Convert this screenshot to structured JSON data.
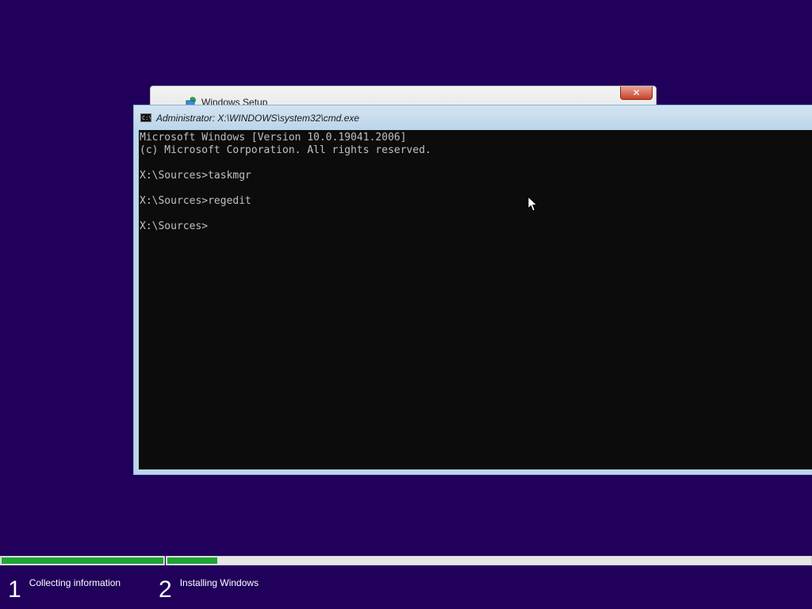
{
  "setup_window": {
    "title": "Windows Setup",
    "close_label": "✕"
  },
  "cmd_window": {
    "title": "Administrator: X:\\WINDOWS\\system32\\cmd.exe",
    "icon_text": "C:\\",
    "lines": [
      "Microsoft Windows [Version 10.0.19041.2006]",
      "(c) Microsoft Corporation. All rights reserved.",
      "",
      "X:\\Sources>taskmgr",
      "",
      "X:\\Sources>regedit",
      "",
      "X:\\Sources>"
    ]
  },
  "progress": {
    "steps": [
      {
        "number": "1",
        "label": "Collecting information",
        "progress": 1.0
      },
      {
        "number": "2",
        "label": "Installing Windows",
        "progress": 0.08
      }
    ]
  },
  "colors": {
    "background": "#20005a",
    "progress_fill": "#1ea534",
    "console_bg": "#0c0c0c",
    "console_text": "#c0c0c0"
  },
  "icons": {
    "setup": "windows-setup-icon",
    "cmd": "cmd-icon",
    "cursor": "mouse-cursor-icon"
  }
}
